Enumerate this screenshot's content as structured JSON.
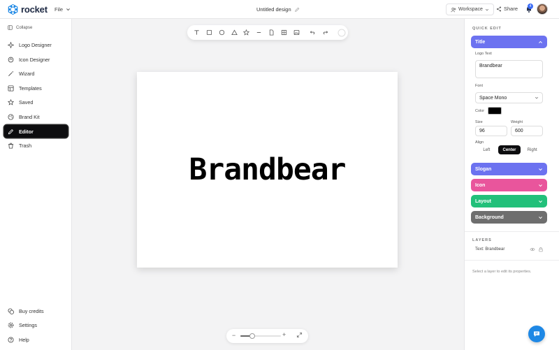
{
  "app": {
    "name": "rocket",
    "brand_color": "#1e88e5"
  },
  "header": {
    "file_menu": "File",
    "doc_title": "Untitled design",
    "workspace": "Workspace",
    "share": "Share",
    "notification_count": "4"
  },
  "sidebar": {
    "collapse": "Collapse",
    "items": [
      {
        "label": "Logo Designer",
        "icon": "sparkle-icon"
      },
      {
        "label": "Icon Designer",
        "icon": "icon-designer-icon"
      },
      {
        "label": "Wizard",
        "icon": "wand-icon"
      },
      {
        "label": "Templates",
        "icon": "templates-icon"
      },
      {
        "label": "Saved",
        "icon": "star-icon"
      },
      {
        "label": "Brand Kit",
        "icon": "brand-kit-icon"
      },
      {
        "label": "Editor",
        "icon": "edit-icon",
        "active": true
      },
      {
        "label": "Trash",
        "icon": "trash-icon"
      }
    ],
    "bottom_items": [
      {
        "label": "Buy credits",
        "icon": "coins-icon"
      },
      {
        "label": "Settings",
        "icon": "gear-icon"
      },
      {
        "label": "Help",
        "icon": "help-icon"
      }
    ]
  },
  "canvas": {
    "logo_text": "Brandbear"
  },
  "zoom": {
    "level_fraction": 0.3
  },
  "quick_edit": {
    "label": "QUICK EDIT",
    "title_section": {
      "label": "Title",
      "color": "#6c72f0",
      "logo_text_label": "Logo Text",
      "logo_text": "Brandbear",
      "font_label": "Font",
      "font": "Space Mono",
      "color_label": "Color",
      "text_color": "#000000",
      "size_label": "Size",
      "size": "96",
      "weight_label": "Weight",
      "weight": "600",
      "align_label": "Align",
      "align_options": [
        "Left",
        "Center",
        "Right"
      ],
      "align_selected": "Center"
    },
    "sections": [
      {
        "label": "Slogan",
        "color": "#6c72f0"
      },
      {
        "label": "Icon",
        "color": "#e9559c"
      },
      {
        "label": "Layout",
        "color": "#22c07a"
      },
      {
        "label": "Background",
        "color": "#6e6e6e"
      }
    ]
  },
  "layers": {
    "label": "LAYERS",
    "items": [
      {
        "label": "Text: Brandbear"
      }
    ],
    "hint": "Select a layer to edit its properties."
  }
}
